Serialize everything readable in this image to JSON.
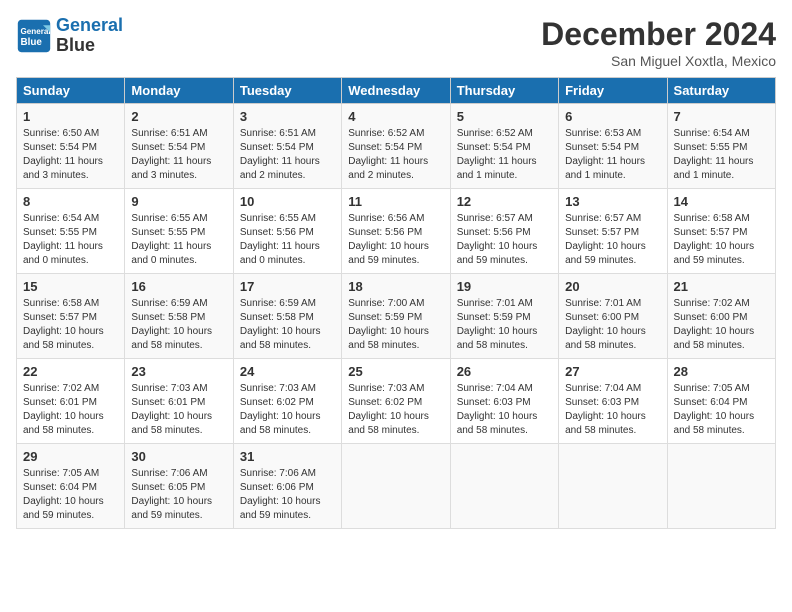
{
  "header": {
    "logo_line1": "General",
    "logo_line2": "Blue",
    "month": "December 2024",
    "location": "San Miguel Xoxtla, Mexico"
  },
  "weekdays": [
    "Sunday",
    "Monday",
    "Tuesday",
    "Wednesday",
    "Thursday",
    "Friday",
    "Saturday"
  ],
  "weeks": [
    [
      {
        "day": "1",
        "info": "Sunrise: 6:50 AM\nSunset: 5:54 PM\nDaylight: 11 hours and 3 minutes."
      },
      {
        "day": "2",
        "info": "Sunrise: 6:51 AM\nSunset: 5:54 PM\nDaylight: 11 hours and 3 minutes."
      },
      {
        "day": "3",
        "info": "Sunrise: 6:51 AM\nSunset: 5:54 PM\nDaylight: 11 hours and 2 minutes."
      },
      {
        "day": "4",
        "info": "Sunrise: 6:52 AM\nSunset: 5:54 PM\nDaylight: 11 hours and 2 minutes."
      },
      {
        "day": "5",
        "info": "Sunrise: 6:52 AM\nSunset: 5:54 PM\nDaylight: 11 hours and 1 minute."
      },
      {
        "day": "6",
        "info": "Sunrise: 6:53 AM\nSunset: 5:54 PM\nDaylight: 11 hours and 1 minute."
      },
      {
        "day": "7",
        "info": "Sunrise: 6:54 AM\nSunset: 5:55 PM\nDaylight: 11 hours and 1 minute."
      }
    ],
    [
      {
        "day": "8",
        "info": "Sunrise: 6:54 AM\nSunset: 5:55 PM\nDaylight: 11 hours and 0 minutes."
      },
      {
        "day": "9",
        "info": "Sunrise: 6:55 AM\nSunset: 5:55 PM\nDaylight: 11 hours and 0 minutes."
      },
      {
        "day": "10",
        "info": "Sunrise: 6:55 AM\nSunset: 5:56 PM\nDaylight: 11 hours and 0 minutes."
      },
      {
        "day": "11",
        "info": "Sunrise: 6:56 AM\nSunset: 5:56 PM\nDaylight: 10 hours and 59 minutes."
      },
      {
        "day": "12",
        "info": "Sunrise: 6:57 AM\nSunset: 5:56 PM\nDaylight: 10 hours and 59 minutes."
      },
      {
        "day": "13",
        "info": "Sunrise: 6:57 AM\nSunset: 5:57 PM\nDaylight: 10 hours and 59 minutes."
      },
      {
        "day": "14",
        "info": "Sunrise: 6:58 AM\nSunset: 5:57 PM\nDaylight: 10 hours and 59 minutes."
      }
    ],
    [
      {
        "day": "15",
        "info": "Sunrise: 6:58 AM\nSunset: 5:57 PM\nDaylight: 10 hours and 58 minutes."
      },
      {
        "day": "16",
        "info": "Sunrise: 6:59 AM\nSunset: 5:58 PM\nDaylight: 10 hours and 58 minutes."
      },
      {
        "day": "17",
        "info": "Sunrise: 6:59 AM\nSunset: 5:58 PM\nDaylight: 10 hours and 58 minutes."
      },
      {
        "day": "18",
        "info": "Sunrise: 7:00 AM\nSunset: 5:59 PM\nDaylight: 10 hours and 58 minutes."
      },
      {
        "day": "19",
        "info": "Sunrise: 7:01 AM\nSunset: 5:59 PM\nDaylight: 10 hours and 58 minutes."
      },
      {
        "day": "20",
        "info": "Sunrise: 7:01 AM\nSunset: 6:00 PM\nDaylight: 10 hours and 58 minutes."
      },
      {
        "day": "21",
        "info": "Sunrise: 7:02 AM\nSunset: 6:00 PM\nDaylight: 10 hours and 58 minutes."
      }
    ],
    [
      {
        "day": "22",
        "info": "Sunrise: 7:02 AM\nSunset: 6:01 PM\nDaylight: 10 hours and 58 minutes."
      },
      {
        "day": "23",
        "info": "Sunrise: 7:03 AM\nSunset: 6:01 PM\nDaylight: 10 hours and 58 minutes."
      },
      {
        "day": "24",
        "info": "Sunrise: 7:03 AM\nSunset: 6:02 PM\nDaylight: 10 hours and 58 minutes."
      },
      {
        "day": "25",
        "info": "Sunrise: 7:03 AM\nSunset: 6:02 PM\nDaylight: 10 hours and 58 minutes."
      },
      {
        "day": "26",
        "info": "Sunrise: 7:04 AM\nSunset: 6:03 PM\nDaylight: 10 hours and 58 minutes."
      },
      {
        "day": "27",
        "info": "Sunrise: 7:04 AM\nSunset: 6:03 PM\nDaylight: 10 hours and 58 minutes."
      },
      {
        "day": "28",
        "info": "Sunrise: 7:05 AM\nSunset: 6:04 PM\nDaylight: 10 hours and 58 minutes."
      }
    ],
    [
      {
        "day": "29",
        "info": "Sunrise: 7:05 AM\nSunset: 6:04 PM\nDaylight: 10 hours and 59 minutes."
      },
      {
        "day": "30",
        "info": "Sunrise: 7:06 AM\nSunset: 6:05 PM\nDaylight: 10 hours and 59 minutes."
      },
      {
        "day": "31",
        "info": "Sunrise: 7:06 AM\nSunset: 6:06 PM\nDaylight: 10 hours and 59 minutes."
      },
      {
        "day": "",
        "info": ""
      },
      {
        "day": "",
        "info": ""
      },
      {
        "day": "",
        "info": ""
      },
      {
        "day": "",
        "info": ""
      }
    ]
  ]
}
